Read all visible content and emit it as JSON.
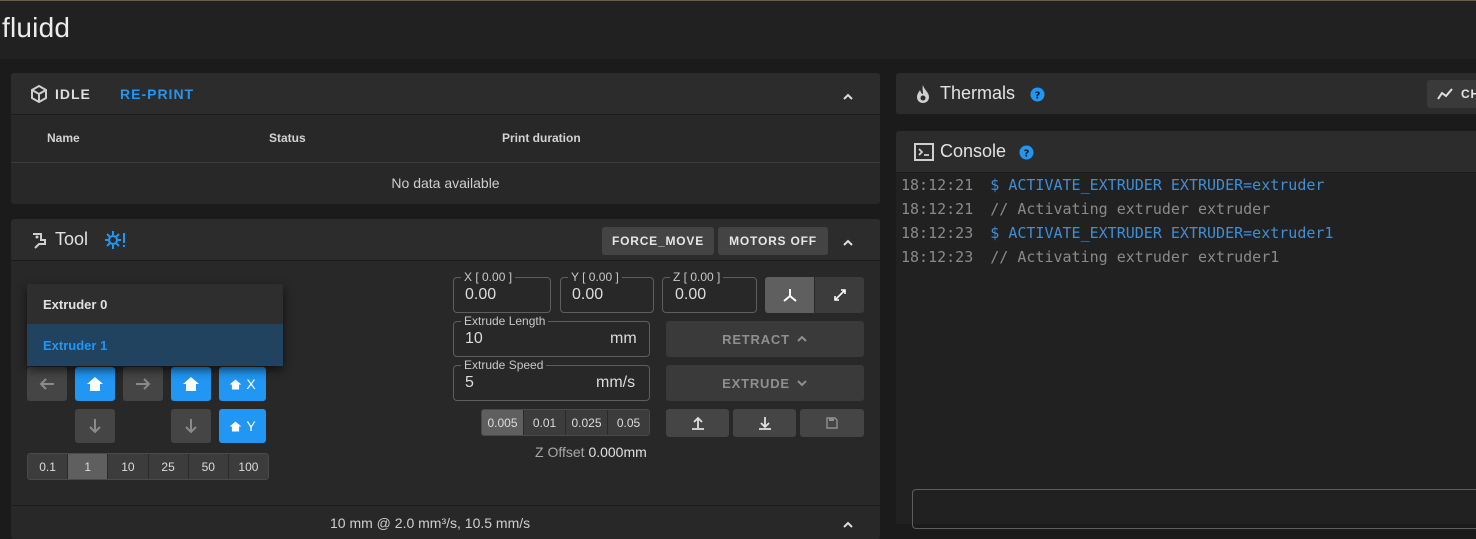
{
  "app": {
    "brand": "fluidd"
  },
  "status_card": {
    "state": "IDLE",
    "reprint": "RE-PRINT",
    "columns": [
      "Name",
      "Status",
      "Print duration"
    ],
    "empty_text": "No data available"
  },
  "tool_card": {
    "title": "Tool",
    "force_move": "FORCE_MOVE",
    "motors_off": "MOTORS OFF",
    "extruders": [
      "Extruder 0",
      "Extruder 1"
    ],
    "selected_extruder": "Extruder 1",
    "home_x": "X",
    "home_y": "Y",
    "xy_steps": [
      "0.1",
      "1",
      "10",
      "25",
      "50",
      "100"
    ],
    "xy_step_selected": "1",
    "pos": {
      "x_label": "X [ 0.00 ]",
      "x_value": "0.00",
      "y_label": "Y [ 0.00 ]",
      "y_value": "0.00",
      "z_label": "Z [ 0.00 ]",
      "z_value": "0.00"
    },
    "extrude_length_label": "Extrude Length",
    "extrude_length": "10",
    "extrude_length_unit": "mm",
    "extrude_speed_label": "Extrude Speed",
    "extrude_speed": "5",
    "extrude_speed_unit": "mm/s",
    "retract": "RETRACT",
    "extrude": "EXTRUDE",
    "z_steps": [
      "0.005",
      "0.01",
      "0.025",
      "0.05"
    ],
    "z_step_selected": "0.005",
    "z_offset_label": "Z Offset",
    "z_offset_value": "0.000mm",
    "footer_text": "10 mm @ 2.0 mm³/s, 10.5 mm/s"
  },
  "thermals": {
    "title": "Thermals",
    "chart_btn": "CH"
  },
  "console": {
    "title": "Console",
    "lines": [
      {
        "time": "18:12:21",
        "text": "$ ACTIVATE_EXTRUDER EXTRUDER=extruder",
        "kind": "command"
      },
      {
        "time": "18:12:21",
        "text": "// Activating extruder extruder",
        "kind": "response"
      },
      {
        "time": "18:12:23",
        "text": "$ ACTIVATE_EXTRUDER EXTRUDER=extruder1",
        "kind": "command"
      },
      {
        "time": "18:12:23",
        "text": "// Activating extruder extruder1",
        "kind": "response"
      }
    ]
  },
  "colors": {
    "accent": "#2196f3",
    "command": "#3f8fd6",
    "response": "#8a8a8a",
    "timestamp": "#8a8a8a"
  }
}
